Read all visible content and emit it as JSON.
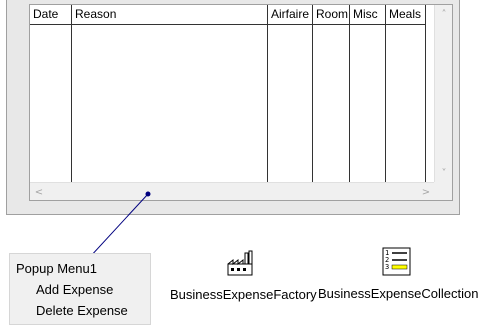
{
  "grid": {
    "columns": [
      {
        "label": "Date"
      },
      {
        "label": "Reason"
      },
      {
        "label": "Airfaire"
      },
      {
        "label": "Room"
      },
      {
        "label": "Misc"
      },
      {
        "label": "Meals"
      }
    ],
    "scroll_up": "˄",
    "scroll_down": "˅",
    "scroll_left": "<",
    "scroll_right": ">"
  },
  "popup_menu": {
    "title": "Popup Menu1",
    "items": [
      "Add Expense",
      "Delete Expense"
    ]
  },
  "components": {
    "factory": {
      "label": "BusinessExpenseFactory",
      "icon": "factory-icon"
    },
    "collection": {
      "label": "BusinessExpenseCollection",
      "icon": "list-icon"
    }
  },
  "colors": {
    "connector": "#00007f",
    "window_bg": "#e8e8e8",
    "grid_border": "#a0a0a0"
  }
}
